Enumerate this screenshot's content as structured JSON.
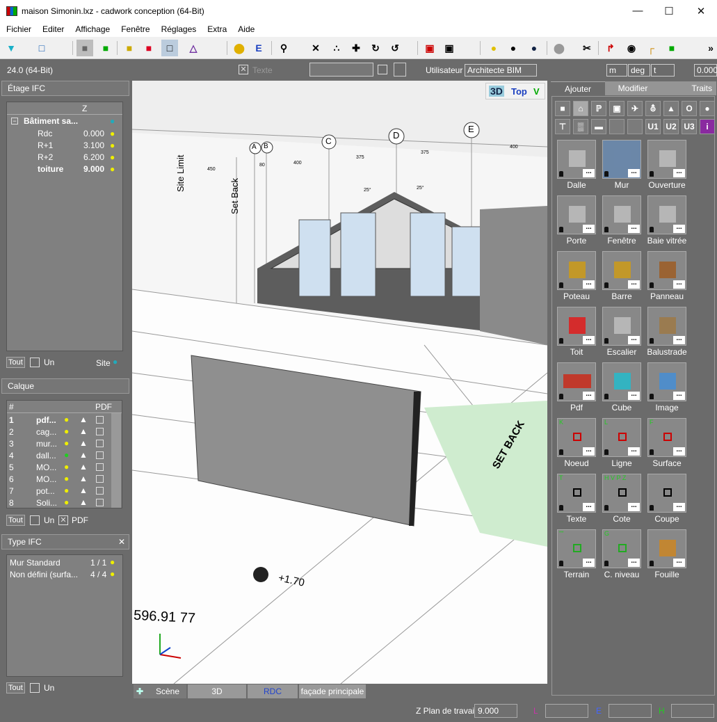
{
  "window": {
    "title": "maison Simonin.lxz - cadwork conception (64-Bit)"
  },
  "menu": [
    "Fichier",
    "Editer",
    "Affichage",
    "Fenêtre",
    "Réglages",
    "Extra",
    "Aide"
  ],
  "infobar": {
    "version": "24.0 (64-Bit)",
    "text_label": "Texte",
    "utilisateur_label": "Utilisateur",
    "utilisateur_value": "Architecte BIM",
    "unit_m": "m",
    "unit_deg": "deg",
    "unit_t": "t",
    "value": "0.000"
  },
  "etage": {
    "title": "Étage IFC",
    "col_z": "Z",
    "building": "Bâtiment sa...",
    "rows": [
      {
        "name": "Rdc",
        "z": "0.000"
      },
      {
        "name": "R+1",
        "z": "3.100"
      },
      {
        "name": "R+2",
        "z": "6.200"
      },
      {
        "name": "toiture",
        "z": "9.000"
      }
    ],
    "tout": "Tout",
    "un": "Un",
    "site": "Site"
  },
  "calque": {
    "title": "Calque",
    "col_num": "#",
    "col_pdf": "PDF",
    "rows": [
      {
        "n": "1",
        "name": "pdf..."
      },
      {
        "n": "2",
        "name": "cag..."
      },
      {
        "n": "3",
        "name": "mur..."
      },
      {
        "n": "4",
        "name": "dall..."
      },
      {
        "n": "5",
        "name": "MO..."
      },
      {
        "n": "6",
        "name": "MO..."
      },
      {
        "n": "7",
        "name": "pot..."
      },
      {
        "n": "8",
        "name": "Soli..."
      }
    ],
    "tout": "Tout",
    "un": "Un",
    "pdf": "PDF"
  },
  "typeifc": {
    "title": "Type IFC",
    "rows": [
      {
        "name": "Mur Standard",
        "count": "1 / 1"
      },
      {
        "name": "Non défini (surfa...",
        "count": "4 / 4"
      }
    ],
    "tout": "Tout",
    "un": "Un"
  },
  "viewport": {
    "btn_3d": "3D",
    "btn_top": "Top",
    "btn_v": "V",
    "labels": {
      "site_limit": "Site Limit",
      "set_back": "Set Back",
      "set_back2": "SET BACK",
      "level": "+1.70",
      "coord": "596.91 77",
      "axes": [
        "A",
        "B",
        "C",
        "D",
        "E"
      ],
      "dims": [
        "375",
        "375",
        "400",
        "400",
        "450",
        "80",
        "25°",
        "25°"
      ]
    }
  },
  "tabs": {
    "scene": "Scène",
    "t3d": "3D",
    "rdc": "RDC",
    "facade": "façade principale"
  },
  "rightpanel": {
    "tabs": [
      "Ajouter",
      "Modifier",
      "Traits"
    ],
    "filters2": [
      "U1",
      "U2",
      "U3",
      "i"
    ],
    "tiles": [
      {
        "label": "Dalle",
        "color": "#bbb"
      },
      {
        "label": "Mur",
        "color": "#6b87a8"
      },
      {
        "label": "Ouverture",
        "color": "#bbb"
      },
      {
        "label": "Porte",
        "color": "#bbb"
      },
      {
        "label": "Fenêtre",
        "color": "#bbb"
      },
      {
        "label": "Baie vitrée",
        "color": "#bbb"
      },
      {
        "label": "Poteau",
        "color": "#c99a1f"
      },
      {
        "label": "Barre",
        "color": "#c99a1f"
      },
      {
        "label": "Panneau",
        "color": "#9c5f2a"
      },
      {
        "label": "Toit",
        "color": "#d22"
      },
      {
        "label": "Escalier",
        "color": "#bbb"
      },
      {
        "label": "Balustrade",
        "color": "#9c7a4a"
      },
      {
        "label": "Pdf",
        "color": "#c0392b"
      },
      {
        "label": "Cube",
        "color": "#2ab8c8"
      },
      {
        "label": "Image",
        "color": "#4a8ed0"
      },
      {
        "label": "Noeud",
        "color": "#c00"
      },
      {
        "label": "Ligne",
        "color": "#c00"
      },
      {
        "label": "Surface",
        "color": "#c00"
      },
      {
        "label": "Texte",
        "color": "#000"
      },
      {
        "label": "Cote",
        "color": "#000"
      },
      {
        "label": "Coupe",
        "color": "#000"
      },
      {
        "label": "Terrain",
        "color": "#2a2"
      },
      {
        "label": "C. niveau",
        "color": "#2a2"
      },
      {
        "label": "Fouille",
        "color": "#c8862a"
      }
    ],
    "tile_tags": {
      "Noeud": "K",
      "Ligne": "L",
      "Surface": "F",
      "Texte": "T",
      "Cote": "H V P Z",
      "Terrain": "\"\"",
      "C. niveau": "G"
    }
  },
  "status": {
    "zplan_label": "Z Plan de travail",
    "zplan_value": "9.000",
    "l": "L",
    "e": "E",
    "h": "H"
  }
}
